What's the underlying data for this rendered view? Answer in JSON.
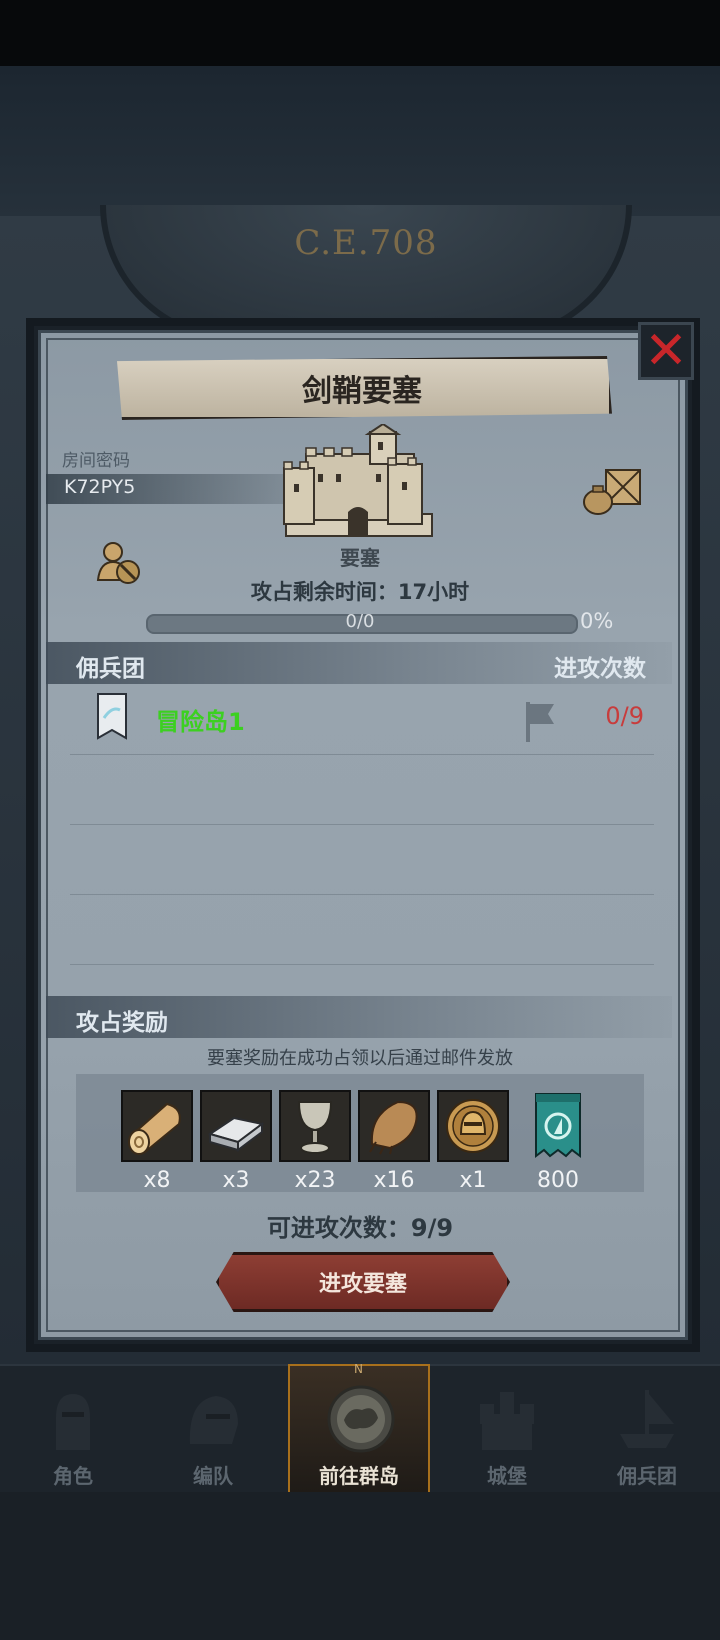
{
  "background": {
    "calendar_year": "C.E.708"
  },
  "dialog": {
    "title": "剑鞘要塞",
    "room_label": "房间密码",
    "room_code": "K72PY5",
    "fortress_label": "要塞",
    "time_remaining": "攻占剩余时间：17小时",
    "progress": {
      "text": "0/0",
      "percent": "0%",
      "fill_fraction": 0.0
    },
    "mercenary_header": "佣兵团",
    "attack_count_header": "进攻次数",
    "mercenaries": [
      {
        "name": "冒险岛1",
        "attacks": "0/9"
      }
    ],
    "rewards_header": "攻占奖励",
    "reward_note": "要塞奖励在成功占领以后通过邮件发放",
    "rewards": [
      {
        "icon": "wood-log-icon",
        "count": "x8"
      },
      {
        "icon": "iron-ingot-icon",
        "count": "x3"
      },
      {
        "icon": "silver-goblet-icon",
        "count": "x23"
      },
      {
        "icon": "fur-pelt-icon",
        "count": "x16"
      },
      {
        "icon": "knight-helmet-coin-icon",
        "count": "x1"
      },
      {
        "icon": "guild-banner-icon",
        "count": "800"
      }
    ],
    "attacks_left": "可进攻次数：9/9",
    "attack_button": "进攻要塞"
  },
  "bottom_nav": [
    {
      "label": "角色",
      "active": false
    },
    {
      "label": "编队",
      "active": false
    },
    {
      "label": "前往群岛",
      "active": true
    },
    {
      "label": "城堡",
      "active": false
    },
    {
      "label": "佣兵团",
      "active": false
    }
  ],
  "colors": {
    "mercenary_name": "#3cd020",
    "attack_count": "#c83c3c",
    "close_x": "#c8262a",
    "active_nav_border": "#a8701c"
  }
}
